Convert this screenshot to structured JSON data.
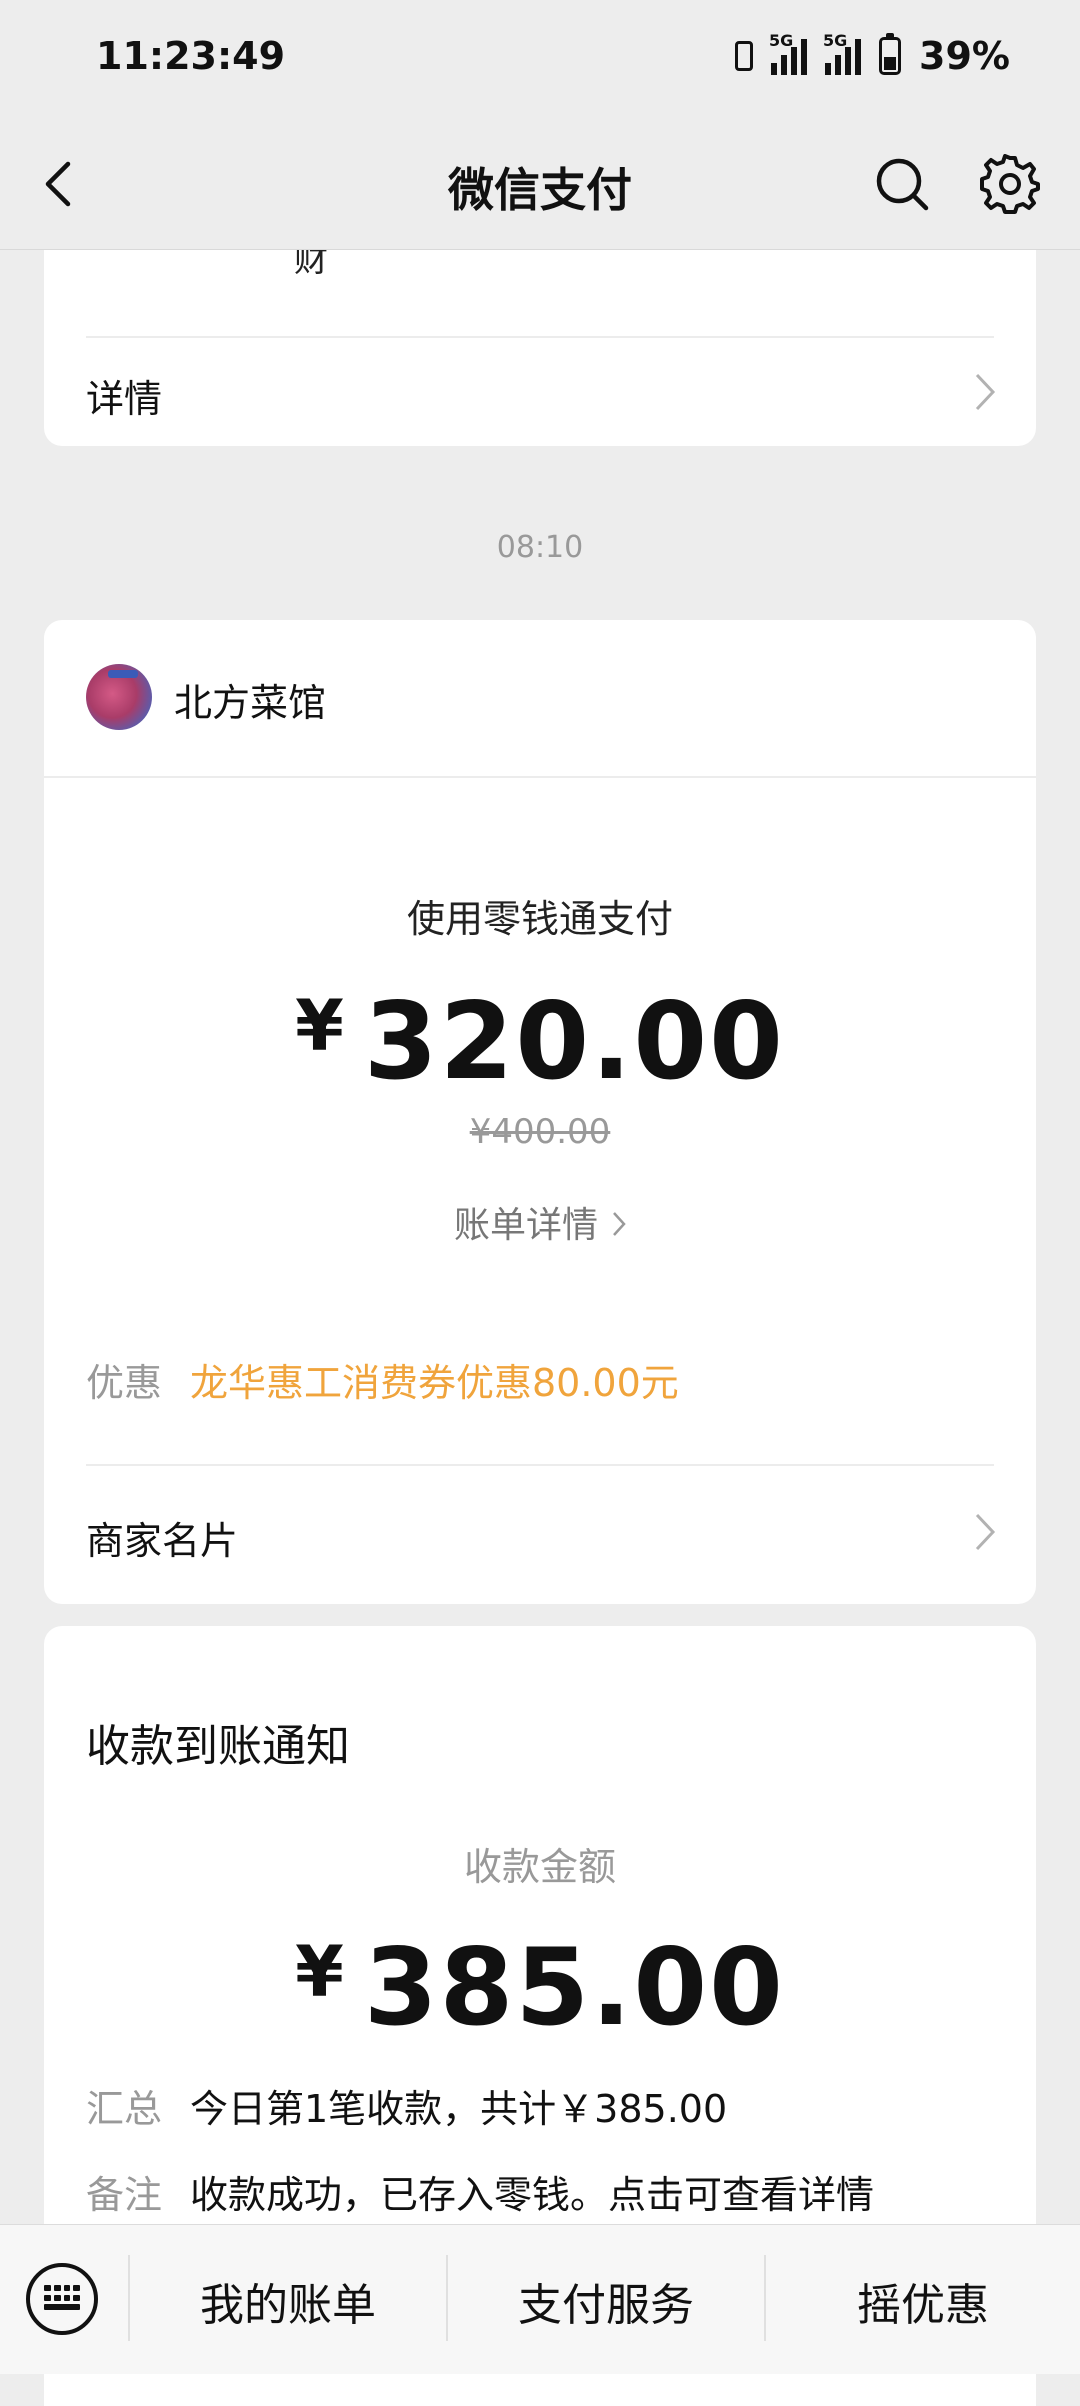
{
  "status_bar": {
    "time": "11:23:49",
    "network1": "5G",
    "network2": "5G",
    "battery": "39%"
  },
  "nav": {
    "title": "微信支付"
  },
  "top_card": {
    "cut_text": "财",
    "details_label": "详情"
  },
  "timestamp": "08:10",
  "payment_card": {
    "merchant_name": "北方菜馆",
    "pay_method": "使用零钱通支付",
    "currency": "¥",
    "amount": "320.00",
    "original_amount": "¥400.00",
    "bill_detail_label": "账单详情",
    "discount_label": "优惠",
    "discount_value": "龙华惠工消费券优惠80.00元",
    "merchant_card_label": "商家名片"
  },
  "receipt_card": {
    "title": "收款到账通知",
    "amount_label": "收款金额",
    "currency": "¥",
    "amount": "385.00",
    "summary_label": "汇总",
    "summary_value": "今日第1笔收款，共计￥385.00",
    "note_label": "备注",
    "note_value": "收款成功，已存入零钱。点击可查看详情"
  },
  "bottom_menu": {
    "items": [
      "我的账单",
      "支付服务",
      "摇优惠"
    ]
  },
  "colors": {
    "background": "#ededed",
    "discount": "#f0a43c",
    "muted": "#999999"
  }
}
